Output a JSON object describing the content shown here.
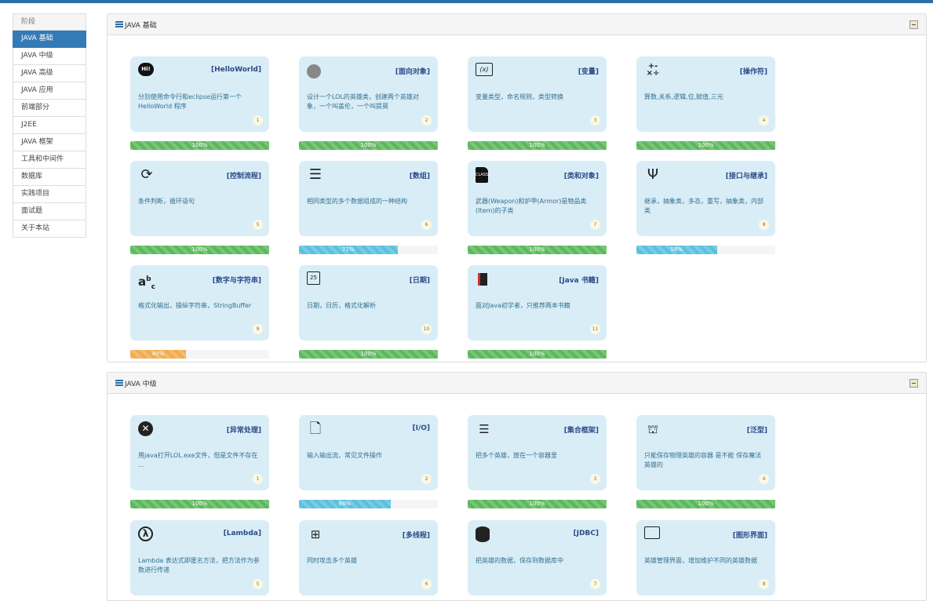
{
  "sidebar": {
    "header": "阶段",
    "items": [
      "JAVA 基础",
      "JAVA 中级",
      "JAVA 高级",
      "JAVA 应用",
      "前端部分",
      "J2EE",
      "JAVA 框架",
      "工具和中间件",
      "数据库",
      "实践项目",
      "面试题",
      "关于本站"
    ],
    "active": "JAVA 基础"
  },
  "panels": [
    {
      "title": "JAVA 基础",
      "cards": [
        {
          "icon": "hi-chat-icon",
          "title": "[HelloWorld]",
          "desc": "分别使用命令行和eclipse运行第一个 HelloWorld 程序",
          "num": "1",
          "progress": 100,
          "progress_label": "100%",
          "bar_color": "#5cb85c"
        },
        {
          "icon": "object-icon",
          "title": "[面向对象]",
          "desc": "设计一个LOL的英雄类，创建两个英雄对象，一个叫盖伦，一个叫提莫",
          "num": "2",
          "progress": 100,
          "progress_label": "100%",
          "bar_color": "#5cb85c"
        },
        {
          "icon": "variable-x-icon",
          "title": "[变量]",
          "desc": "变量类型，命名规则，类型转换",
          "num": "3",
          "progress": 100,
          "progress_label": "100%",
          "bar_color": "#5cb85c"
        },
        {
          "icon": "operators-icon",
          "title": "[操作符]",
          "desc": "算数,关系,逻辑,位,赋值,三元",
          "num": "4",
          "progress": 100,
          "progress_label": "100%",
          "bar_color": "#5cb85c"
        },
        {
          "icon": "loop-arrows-icon",
          "title": "[控制流程]",
          "desc": "条件判断，循环语句",
          "num": "5",
          "progress": 100,
          "progress_label": "100%",
          "bar_color": "#5cb85c"
        },
        {
          "icon": "list-icon",
          "title": "[数组]",
          "desc": "相同类型的多个数据组成的一种结构",
          "num": "6",
          "progress": 71,
          "progress_label": "71%",
          "bar_color": "#5bc0de"
        },
        {
          "icon": "class-file-icon",
          "title": "[类和对象]",
          "desc": "武器(Weapon)和护甲(Armor)是物品类(Item)的子类",
          "num": "7",
          "progress": 100,
          "progress_label": "100%",
          "bar_color": "#5cb85c"
        },
        {
          "icon": "usb-icon",
          "title": "[接口与继承]",
          "desc": "继承，抽象类，多态，重写，抽象类，内部类",
          "num": "8",
          "progress": 58,
          "progress_label": "58%",
          "bar_color": "#5bc0de"
        },
        {
          "icon": "abc-icon",
          "title": "[数字与字符串]",
          "desc": "格式化输出，操纵字符串，StringBuffer",
          "num": "9",
          "progress": 40,
          "progress_label": "40%",
          "bar_color": "#f0ad4e"
        },
        {
          "icon": "calendar-icon",
          "title": "[日期]",
          "desc": "日期，日历，格式化解析",
          "num": "10",
          "progress": 100,
          "progress_label": "100%",
          "bar_color": "#5cb85c"
        },
        {
          "icon": "book-icon",
          "title": "[Java 书籍]",
          "desc": "面对Java初学者，只推荐两本书籍",
          "num": "11",
          "progress": 100,
          "progress_label": "100%",
          "bar_color": "#5cb85c"
        }
      ]
    },
    {
      "title": "JAVA 中级",
      "cards": [
        {
          "icon": "error-x-icon",
          "title": "[异常处理]",
          "desc": "用java打开LOL.exe文件，但是文件不存在 ...",
          "num": "1",
          "progress": 100,
          "progress_label": "100%",
          "bar_color": "#5cb85c"
        },
        {
          "icon": "file-icon",
          "title": "[I/O]",
          "desc": "输入输出流，常见文件操作",
          "num": "2",
          "progress": 66,
          "progress_label": "66%",
          "bar_color": "#5bc0de"
        },
        {
          "icon": "numbered-list-icon",
          "title": "[集合框架]",
          "desc": "把多个英雄，放在一个容器里",
          "num": "3",
          "progress": 100,
          "progress_label": "100%",
          "bar_color": "#5cb85c"
        },
        {
          "icon": "cage-icon",
          "title": "[泛型]",
          "desc": "只能保存物理英雄的容器 是不能 保存魔法英雄的",
          "num": "4",
          "progress": 100,
          "progress_label": "100%",
          "bar_color": "#5cb85c"
        },
        {
          "icon": "lambda-icon",
          "title": "[Lambda]",
          "desc": "Lambda 表达式即匿名方法，把方法作为参数进行传递",
          "num": "5"
        },
        {
          "icon": "sitemap-icon",
          "title": "[多线程]",
          "desc": "同时攻击多个英雄",
          "num": "6"
        },
        {
          "icon": "database-icon",
          "title": "[JDBC]",
          "desc": "把英雄的数据，保存到数据库中",
          "num": "7"
        },
        {
          "icon": "window-layout-icon",
          "title": "[图形界面]",
          "desc": "英雄管理界面，增加维护不同的英雄数据",
          "num": "8"
        }
      ]
    }
  ]
}
